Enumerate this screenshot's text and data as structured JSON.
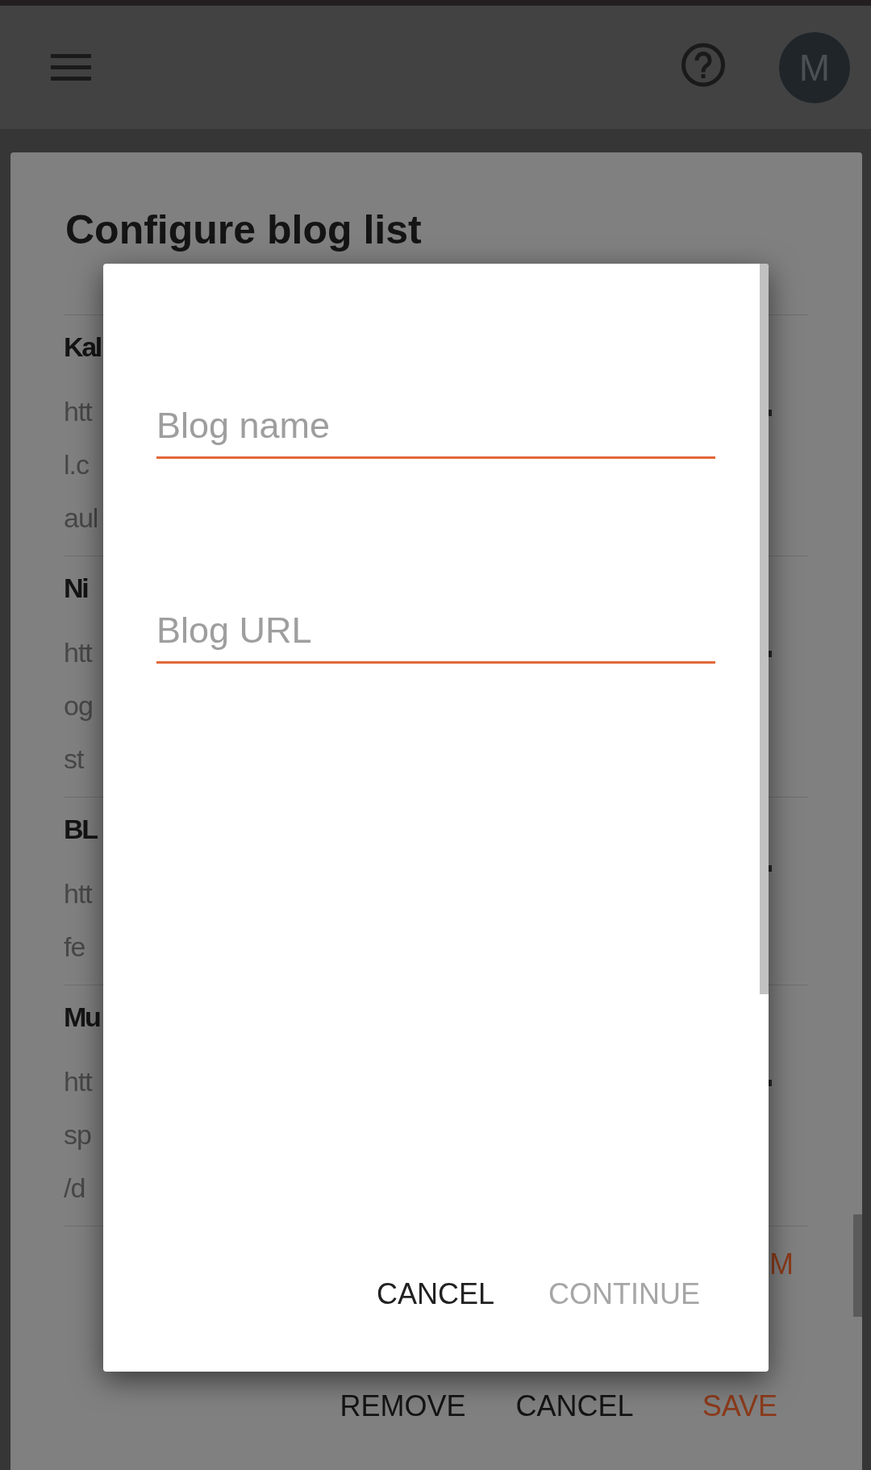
{
  "app_bar": {
    "avatar": {
      "letter": "M"
    }
  },
  "panel": {
    "title": "Configure blog list",
    "blogs": [
      {
        "name": "Kal",
        "url_lines": [
          "htt",
          "l.c",
          "aul"
        ]
      },
      {
        "name": "Ni",
        "url_lines": [
          "htt",
          "og",
          "st"
        ]
      },
      {
        "name": "BL",
        "url_lines": [
          "htt",
          "fe"
        ]
      },
      {
        "name": "Mu",
        "url_lines": [
          "htt",
          "sp",
          "/d"
        ]
      }
    ],
    "side_button": {
      "label": "M"
    },
    "actions": [
      {
        "label": "REMOVE",
        "kind": "default"
      },
      {
        "label": "CANCEL",
        "kind": "default"
      },
      {
        "label": "SAVE",
        "kind": "primary"
      }
    ]
  },
  "dialog": {
    "fields": [
      {
        "placeholder": "Blog name"
      },
      {
        "placeholder": "Blog URL"
      }
    ],
    "actions": [
      {
        "label": "CANCEL",
        "disabled": false
      },
      {
        "label": "CONTINUE",
        "disabled": true
      }
    ]
  }
}
